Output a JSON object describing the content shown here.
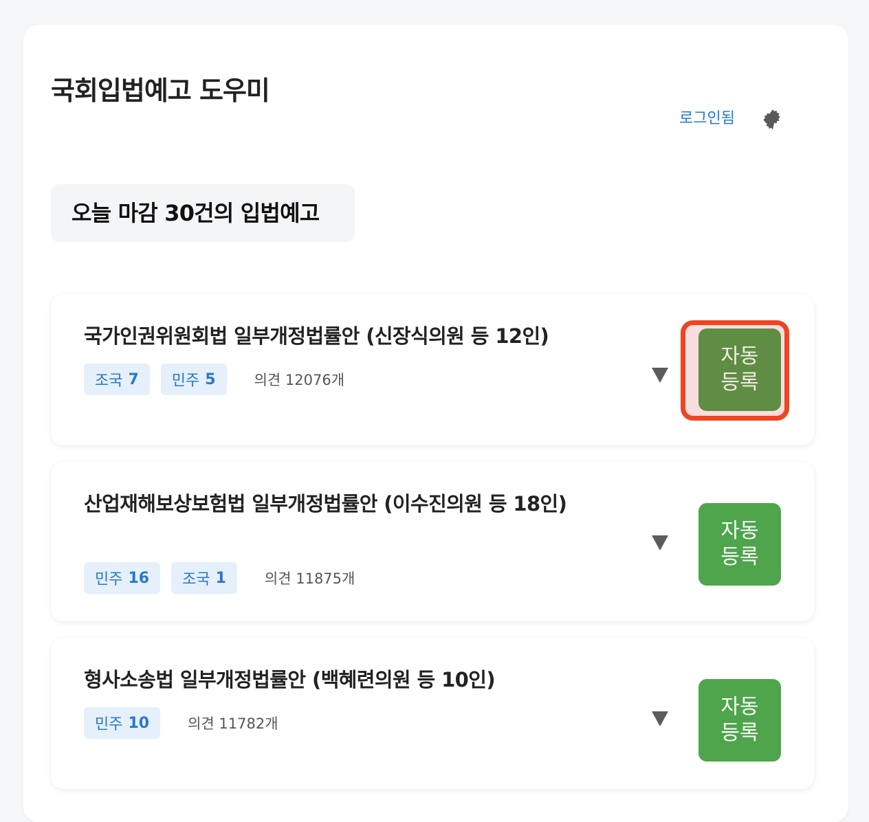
{
  "header": {
    "app_title": "국회입법예고 도우미",
    "login_status": "로그인됨",
    "settings_icon": "gear-icon"
  },
  "summary": {
    "text": "오늘 마감 30건의 입법예고"
  },
  "bills": [
    {
      "title": "국가인권위원회법 일부개정법률안 (신장식의원 등 12인)",
      "parties": [
        {
          "name": "조국",
          "count": "7"
        },
        {
          "name": "민주",
          "count": "5"
        }
      ],
      "opinions": "의견 12076개",
      "expand_icon": "triangle-down-icon",
      "button_line1": "자동",
      "button_line2": "등록",
      "highlighted": true
    },
    {
      "title": "산업재해보상보험법 일부개정법률안 (이수진의원 등 18인)",
      "parties": [
        {
          "name": "민주",
          "count": "16"
        },
        {
          "name": "조국",
          "count": "1"
        }
      ],
      "opinions": "의견 11875개",
      "expand_icon": "triangle-down-icon",
      "button_line1": "자동",
      "button_line2": "등록",
      "highlighted": false
    },
    {
      "title": "형사소송법 일부개정법률안 (백혜련의원 등 10인)",
      "parties": [
        {
          "name": "민주",
          "count": "10"
        }
      ],
      "opinions": "의견 11782개",
      "expand_icon": "triangle-down-icon",
      "button_line1": "자동",
      "button_line2": "등록",
      "highlighted": false
    }
  ],
  "colors": {
    "accent_link": "#1f7ae0",
    "button_green": "#4ea54c",
    "button_green_highlighted": "#5f8d44",
    "highlight_border": "#ee4523",
    "badge_bg": "#e5f0fb",
    "badge_text": "#2b78c8"
  }
}
